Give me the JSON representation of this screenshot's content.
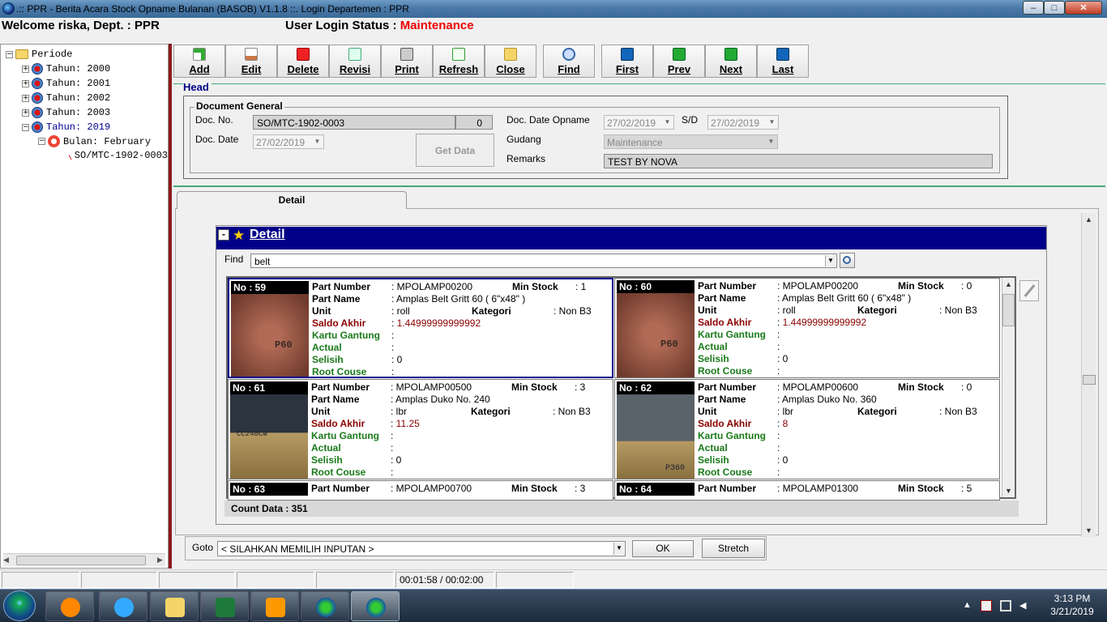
{
  "window": {
    "title": ".:: PPR - Berita Acara Stock Opname Bulanan (BASOB) V1.1.8 ::.  Login Departemen : PPR",
    "min": "‒",
    "max": "□",
    "close": "✕"
  },
  "header": {
    "welcome": "Welcome riska, Dept. : PPR",
    "login_label": "User Login Status : ",
    "login_value": "Maintenance"
  },
  "tree": {
    "root": "Periode",
    "years": [
      "Tahun: 2000",
      "Tahun: 2001",
      "Tahun: 2002",
      "Tahun: 2003",
      "Tahun: 2019"
    ],
    "month": "Bulan: February",
    "doc": "SO/MTC-1902-0003"
  },
  "toolbar": {
    "add": "Add",
    "edit": "Edit",
    "delete": "Delete",
    "revisi": "Revisi",
    "print": "Print",
    "refresh": "Refresh",
    "close": "Close",
    "find": "Find",
    "first": "First",
    "prev": "Prev",
    "next": "Next",
    "last": "Last"
  },
  "head": {
    "section_label": "Head",
    "group_label": "Document General",
    "doc_no_label": "Doc. No.",
    "doc_no_value": "SO/MTC-1902-0003",
    "doc_no_rev": "0",
    "doc_date_label": "Doc. Date",
    "doc_date_value": "27/02/2019",
    "get_data": "Get Data",
    "opname_label": "Doc. Date Opname",
    "opname_from": "27/02/2019",
    "sd_label": "S/D",
    "opname_to": "27/02/2019",
    "gudang_label": "Gudang",
    "gudang_value": "Maintenance",
    "remarks_label": "Remarks",
    "remarks_value": "TEST BY NOVA"
  },
  "detail": {
    "tab_label": "Detail",
    "panel_title": "Detail",
    "find_label": "Find",
    "find_value": "belt",
    "count_label": "Count Data : 351",
    "labels": {
      "part_number": "Part Number",
      "part_name": "Part Name",
      "unit": "Unit",
      "saldo_akhir": "Saldo Akhir",
      "kartu_gantung": "Kartu Gantung",
      "actual": "Actual",
      "selisih": "Selisih",
      "root_couse": "Root Couse",
      "min_stock": "Min Stock",
      "kategori": "Kategori"
    },
    "items": [
      {
        "no": "No : 59",
        "part_number": ": MPOLAMP00200",
        "min_stock": ": 1",
        "part_name": ": Amplas Belt Gritt 60 ( 6\"x48\" )",
        "unit": ": roll",
        "kategori": ": Non B3",
        "saldo_akhir": "1.44999999999992",
        "kartu_gantung": ":",
        "actual": ":",
        "selisih": ": 0",
        "root_couse": ":",
        "photo": "red-sandpaper",
        "image_text": "P60"
      },
      {
        "no": "No : 60",
        "part_number": ": MPOLAMP00200",
        "min_stock": ": 0",
        "part_name": ": Amplas Belt Gritt 60 ( 6\"x48\" )",
        "unit": ": roll",
        "kategori": ": Non B3",
        "saldo_akhir": "1.44999999999992",
        "kartu_gantung": ":",
        "actual": ":",
        "selisih": ": 0",
        "root_couse": ":",
        "photo": "red-sandpaper",
        "image_text": "P60"
      },
      {
        "no": "No : 61",
        "part_number": ": MPOLAMP00500",
        "min_stock": ": 3",
        "part_name": ": Amplas Duko No. 240",
        "unit": ": lbr",
        "kategori": ": Non B3",
        "saldo_akhir": "11.25",
        "kartu_gantung": ":",
        "actual": ":",
        "selisih": ": 0",
        "root_couse": ":",
        "photo": "dark-sandpaper",
        "image_text": "CC240Cw"
      },
      {
        "no": "No : 62",
        "part_number": ": MPOLAMP00600",
        "min_stock": ": 0",
        "part_name": ": Amplas Duko No. 360",
        "unit": ": lbr",
        "kategori": ": Non B3",
        "saldo_akhir": "8",
        "kartu_gantung": ":",
        "actual": ":",
        "selisih": ": 0",
        "root_couse": ":",
        "photo": "grey-sandpaper",
        "image_text": "P360"
      }
    ],
    "partial_items": [
      {
        "no": "No : 63",
        "part_number": ": MPOLAMP00700",
        "min_stock": ": 3"
      },
      {
        "no": "No : 64",
        "part_number": ": MPOLAMP01300",
        "min_stock": ": 5"
      }
    ]
  },
  "goto": {
    "label": "Goto",
    "value": "< SILAHKAN MEMILIH INPUTAN >",
    "ok": "OK",
    "stretch": "Stretch"
  },
  "status": {
    "timer": "00:01:58 / 00:02:00"
  },
  "taskbar": {
    "time": "3:13 PM",
    "date": "3/21/2019",
    "apps": [
      "media-player-icon",
      "internet-explorer-icon",
      "file-explorer-icon",
      "excel-icon",
      "outlook-icon",
      "globe-app-icon",
      "globe-app-icon"
    ]
  },
  "colors": {
    "detail_header_bg": "#000088",
    "login_status": "#ee0000",
    "saldo_red": "#8b0000",
    "label_green": "#1a7a1a",
    "splitter": "#8b1b1b"
  }
}
